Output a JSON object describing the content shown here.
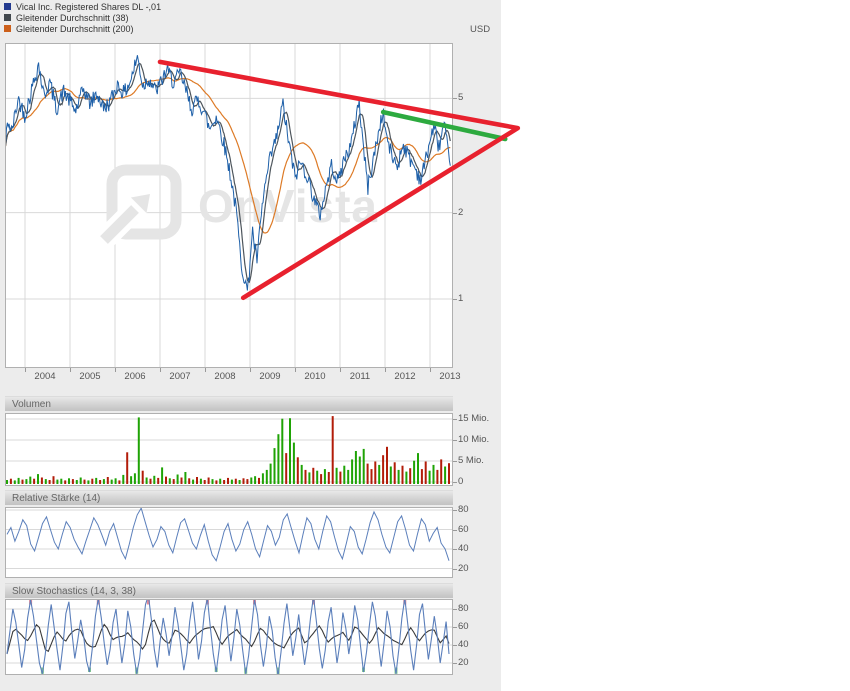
{
  "page": {
    "background": "#ffffff",
    "widget_background": "#ececec"
  },
  "legend": {
    "items": [
      {
        "label": "Vical Inc. Registered Shares DL -,01",
        "color": "#233a8f"
      },
      {
        "label": "Gleitender Durchschnitt (38)",
        "color": "#42484d"
      },
      {
        "label": "Gleitender Durchschnitt (200)",
        "color": "#cc5f1a"
      }
    ]
  },
  "axis": {
    "currency_label": "USD"
  },
  "watermark": {
    "text": "OnVista",
    "color": "#e5e5e5"
  },
  "chart_data": [
    {
      "id": "price",
      "type": "line",
      "yscale": "log",
      "ylabel": "USD",
      "yticks": [
        "5",
        "2",
        "1"
      ],
      "ytick_values": [
        5,
        2,
        1
      ],
      "x_years": [
        "2004",
        "2005",
        "2006",
        "2007",
        "2008",
        "2009",
        "2010",
        "2011",
        "2012",
        "2013"
      ],
      "series": [
        {
          "name": "Vical Inc. Registered Shares DL -,01",
          "color": "#1d5fa8",
          "anchors": [
            [
              2003.55,
              3.3
            ],
            [
              2003.62,
              4.2
            ],
            [
              2003.7,
              3.8
            ],
            [
              2003.85,
              5.0
            ],
            [
              2004.0,
              4.35
            ],
            [
              2004.15,
              5.4
            ],
            [
              2004.3,
              6.6
            ],
            [
              2004.42,
              5.1
            ],
            [
              2004.55,
              5.7
            ],
            [
              2004.7,
              4.6
            ],
            [
              2004.85,
              5.3
            ],
            [
              2005.0,
              4.9
            ],
            [
              2005.12,
              4.5
            ],
            [
              2005.3,
              5.4
            ],
            [
              2005.45,
              4.8
            ],
            [
              2005.6,
              5.2
            ],
            [
              2005.75,
              4.6
            ],
            [
              2005.9,
              4.9
            ],
            [
              2006.05,
              5.6
            ],
            [
              2006.2,
              5.2
            ],
            [
              2006.35,
              5.8
            ],
            [
              2006.5,
              7.0
            ],
            [
              2006.62,
              5.5
            ],
            [
              2006.75,
              5.9
            ],
            [
              2006.9,
              5.3
            ],
            [
              2007.0,
              5.6
            ],
            [
              2007.15,
              6.3
            ],
            [
              2007.3,
              5.7
            ],
            [
              2007.45,
              6.1
            ],
            [
              2007.6,
              5.2
            ],
            [
              2007.7,
              4.6
            ],
            [
              2007.85,
              4.95
            ],
            [
              2008.0,
              4.4
            ],
            [
              2008.1,
              3.9
            ],
            [
              2008.25,
              4.35
            ],
            [
              2008.4,
              3.6
            ],
            [
              2008.55,
              2.8
            ],
            [
              2008.7,
              2.0
            ],
            [
              2008.8,
              1.35
            ],
            [
              2008.95,
              1.05
            ],
            [
              2009.05,
              1.75
            ],
            [
              2009.15,
              1.35
            ],
            [
              2009.3,
              2.3
            ],
            [
              2009.45,
              3.1
            ],
            [
              2009.6,
              3.7
            ],
            [
              2009.73,
              4.8
            ],
            [
              2009.85,
              3.6
            ],
            [
              2010.0,
              2.65
            ],
            [
              2010.12,
              3.0
            ],
            [
              2010.25,
              2.75
            ],
            [
              2010.4,
              2.3
            ],
            [
              2010.55,
              1.95
            ],
            [
              2010.7,
              2.5
            ],
            [
              2010.82,
              2.95
            ],
            [
              2010.95,
              2.55
            ],
            [
              2011.1,
              3.1
            ],
            [
              2011.25,
              3.45
            ],
            [
              2011.42,
              4.95
            ],
            [
              2011.52,
              3.4
            ],
            [
              2011.62,
              2.45
            ],
            [
              2011.78,
              3.3
            ],
            [
              2011.95,
              4.5
            ],
            [
              2012.05,
              3.6
            ],
            [
              2012.15,
              3.15
            ],
            [
              2012.28,
              2.9
            ],
            [
              2012.4,
              3.5
            ],
            [
              2012.52,
              3.15
            ],
            [
              2012.65,
              2.9
            ],
            [
              2012.8,
              2.6
            ],
            [
              2012.95,
              3.3
            ],
            [
              2013.08,
              4.0
            ],
            [
              2013.2,
              3.4
            ],
            [
              2013.32,
              4.1
            ],
            [
              2013.45,
              2.75
            ]
          ]
        },
        {
          "name": "Gleitender Durchschnitt (38)",
          "color": "#4d555c",
          "derived": "moving_average",
          "window_days": 38
        },
        {
          "name": "Gleitender Durchschnitt (200)",
          "color": "#dd7a26",
          "derived": "moving_average",
          "window_days": 200
        }
      ],
      "annotations": {
        "red_trend_color": "#e8212e",
        "green_trend_color": "#2daa3f",
        "upper_red": [
          [
            2007.0,
            6.7
          ],
          [
            2014.95,
            3.94
          ]
        ],
        "lower_red": [
          [
            2008.85,
            1.01
          ],
          [
            2014.95,
            3.94
          ]
        ],
        "green": [
          [
            2011.96,
            4.48
          ],
          [
            2014.67,
            3.61
          ]
        ]
      }
    },
    {
      "id": "volume",
      "type": "bar",
      "title": "Volumen",
      "unit": "Mio.",
      "yticks": [
        "15 Mio.",
        "10 Mio.",
        "5 Mio.",
        "0"
      ],
      "ytick_values": [
        15,
        10,
        5,
        0
      ],
      "up_color": "#1fa305",
      "down_color": "#b21c09",
      "bars": [
        [
          0.6,
          "g"
        ],
        [
          0.9,
          "r"
        ],
        [
          0.5,
          "g"
        ],
        [
          1.1,
          "g"
        ],
        [
          0.7,
          "r"
        ],
        [
          0.8,
          "g"
        ],
        [
          1.4,
          "g"
        ],
        [
          0.9,
          "r"
        ],
        [
          2.0,
          "g"
        ],
        [
          1.2,
          "r"
        ],
        [
          0.8,
          "g"
        ],
        [
          0.6,
          "r"
        ],
        [
          1.5,
          "r"
        ],
        [
          0.7,
          "g"
        ],
        [
          0.9,
          "g"
        ],
        [
          0.5,
          "r"
        ],
        [
          1.0,
          "g"
        ],
        [
          0.8,
          "r"
        ],
        [
          0.6,
          "g"
        ],
        [
          1.2,
          "g"
        ],
        [
          0.7,
          "r"
        ],
        [
          0.5,
          "g"
        ],
        [
          0.9,
          "r"
        ],
        [
          1.1,
          "g"
        ],
        [
          0.6,
          "r"
        ],
        [
          0.8,
          "g"
        ],
        [
          1.3,
          "r"
        ],
        [
          0.7,
          "g"
        ],
        [
          1.0,
          "g"
        ],
        [
          0.5,
          "r"
        ],
        [
          1.8,
          "g"
        ],
        [
          7.2,
          "r"
        ],
        [
          1.5,
          "g"
        ],
        [
          2.2,
          "g"
        ],
        [
          15.5,
          "g"
        ],
        [
          2.8,
          "r"
        ],
        [
          1.2,
          "g"
        ],
        [
          0.9,
          "r"
        ],
        [
          1.6,
          "g"
        ],
        [
          1.1,
          "r"
        ],
        [
          3.6,
          "g"
        ],
        [
          1.4,
          "r"
        ],
        [
          1.0,
          "g"
        ],
        [
          0.8,
          "r"
        ],
        [
          1.9,
          "g"
        ],
        [
          1.2,
          "r"
        ],
        [
          2.5,
          "g"
        ],
        [
          1.0,
          "r"
        ],
        [
          0.7,
          "g"
        ],
        [
          1.3,
          "r"
        ],
        [
          0.9,
          "g"
        ],
        [
          0.6,
          "r"
        ],
        [
          1.2,
          "r"
        ],
        [
          0.8,
          "g"
        ],
        [
          0.5,
          "r"
        ],
        [
          0.9,
          "g"
        ],
        [
          0.6,
          "r"
        ],
        [
          1.1,
          "r"
        ],
        [
          0.7,
          "g"
        ],
        [
          0.9,
          "r"
        ],
        [
          0.6,
          "g"
        ],
        [
          1.0,
          "r"
        ],
        [
          0.8,
          "r"
        ],
        [
          1.2,
          "g"
        ],
        [
          1.5,
          "g"
        ],
        [
          1.1,
          "r"
        ],
        [
          2.2,
          "g"
        ],
        [
          3.0,
          "g"
        ],
        [
          4.5,
          "g"
        ],
        [
          8.2,
          "g"
        ],
        [
          11.5,
          "g"
        ],
        [
          15.2,
          "g"
        ],
        [
          7.0,
          "r"
        ],
        [
          15.3,
          "g"
        ],
        [
          9.5,
          "g"
        ],
        [
          6.0,
          "r"
        ],
        [
          4.2,
          "g"
        ],
        [
          3.0,
          "r"
        ],
        [
          2.4,
          "g"
        ],
        [
          3.5,
          "r"
        ],
        [
          2.8,
          "g"
        ],
        [
          2.0,
          "r"
        ],
        [
          3.2,
          "g"
        ],
        [
          2.5,
          "r"
        ],
        [
          15.8,
          "r"
        ],
        [
          3.5,
          "g"
        ],
        [
          2.6,
          "r"
        ],
        [
          4.0,
          "g"
        ],
        [
          3.0,
          "g"
        ],
        [
          5.5,
          "g"
        ],
        [
          7.5,
          "g"
        ],
        [
          6.2,
          "g"
        ],
        [
          8.0,
          "g"
        ],
        [
          4.5,
          "r"
        ],
        [
          3.2,
          "r"
        ],
        [
          5.0,
          "r"
        ],
        [
          4.2,
          "g"
        ],
        [
          6.5,
          "r"
        ],
        [
          8.5,
          "r"
        ],
        [
          3.8,
          "g"
        ],
        [
          4.8,
          "r"
        ],
        [
          3.0,
          "g"
        ],
        [
          4.0,
          "r"
        ],
        [
          2.6,
          "g"
        ],
        [
          3.4,
          "r"
        ],
        [
          5.2,
          "g"
        ],
        [
          7.0,
          "g"
        ],
        [
          3.2,
          "r"
        ],
        [
          5.0,
          "r"
        ],
        [
          2.8,
          "g"
        ],
        [
          4.2,
          "g"
        ],
        [
          3.0,
          "r"
        ],
        [
          5.5,
          "r"
        ],
        [
          3.8,
          "g"
        ],
        [
          4.6,
          "r"
        ]
      ]
    },
    {
      "id": "rsi",
      "type": "line",
      "title": "Relative Stärke (14)",
      "yticks": [
        "80",
        "60",
        "40",
        "20"
      ],
      "ytick_values": [
        80,
        60,
        40,
        20
      ],
      "color": "#5b7fbb",
      "values": [
        55,
        62,
        48,
        58,
        70,
        64,
        45,
        38,
        52,
        66,
        73,
        60,
        47,
        40,
        55,
        68,
        62,
        50,
        42,
        35,
        48,
        60,
        72,
        65,
        55,
        44,
        58,
        66,
        52,
        38,
        30,
        45,
        62,
        75,
        82,
        68,
        54,
        42,
        50,
        63,
        58,
        44,
        36,
        52,
        67,
        71,
        59,
        46,
        40,
        54,
        65,
        48,
        34,
        28,
        42,
        58,
        66,
        50,
        38,
        45,
        60,
        68,
        55,
        40,
        32,
        48,
        64,
        58,
        44,
        52,
        70,
        76,
        62,
        48,
        36,
        55,
        72,
        66,
        50,
        40,
        58,
        74,
        68,
        52,
        38,
        30,
        46,
        63,
        58,
        42,
        35,
        50,
        67,
        78,
        70,
        55,
        42,
        36,
        52,
        68,
        74,
        60,
        44,
        38,
        55,
        71,
        65,
        48,
        56,
        62,
        46,
        40,
        28
      ]
    },
    {
      "id": "stochastics",
      "type": "line",
      "title": "Slow Stochastics (14, 3, 38)",
      "yticks": [
        "80",
        "60",
        "40",
        "20"
      ],
      "ytick_values": [
        80,
        60,
        40,
        20
      ],
      "k_color": "#5b7fbb",
      "d_color": "#3a3a3a",
      "overbought_color": "#e78a96",
      "oversold_color": "#86cf8d",
      "k_values": [
        30,
        55,
        80,
        65,
        40,
        15,
        35,
        70,
        90,
        72,
        45,
        20,
        8,
        30,
        62,
        85,
        60,
        35,
        12,
        40,
        75,
        88,
        55,
        25,
        45,
        68,
        50,
        22,
        10,
        38,
        72,
        92,
        70,
        42,
        18,
        35,
        65,
        80,
        48,
        20,
        42,
        78,
        60,
        30,
        8,
        25,
        55,
        85,
        95,
        68,
        35,
        15,
        45,
        70,
        52,
        28,
        50,
        82,
        64,
        38,
        12,
        30,
        66,
        88,
        58,
        24,
        44,
        76,
        92,
        60,
        30,
        10,
        36,
        68,
        84,
        52,
        22,
        48,
        80,
        62,
        34,
        8,
        28,
        60,
        90,
        74,
        40,
        16,
        38,
        72,
        56,
        26,
        6,
        32,
        64,
        86,
        58,
        28,
        48,
        74,
        44,
        18,
        40,
        70,
        94,
        66,
        36,
        14,
        34,
        66,
        82,
        50,
        20,
        42,
        76,
        58,
        30,
        52,
        84,
        68,
        38,
        10,
        32,
        62,
        88,
        72,
        42,
        16,
        44,
        78,
        60,
        28,
        8,
        36,
        70,
        92,
        64,
        34,
        12,
        40,
        74,
        86,
        54,
        24,
        46,
        72,
        50,
        20,
        42,
        66,
        30
      ]
    }
  ]
}
